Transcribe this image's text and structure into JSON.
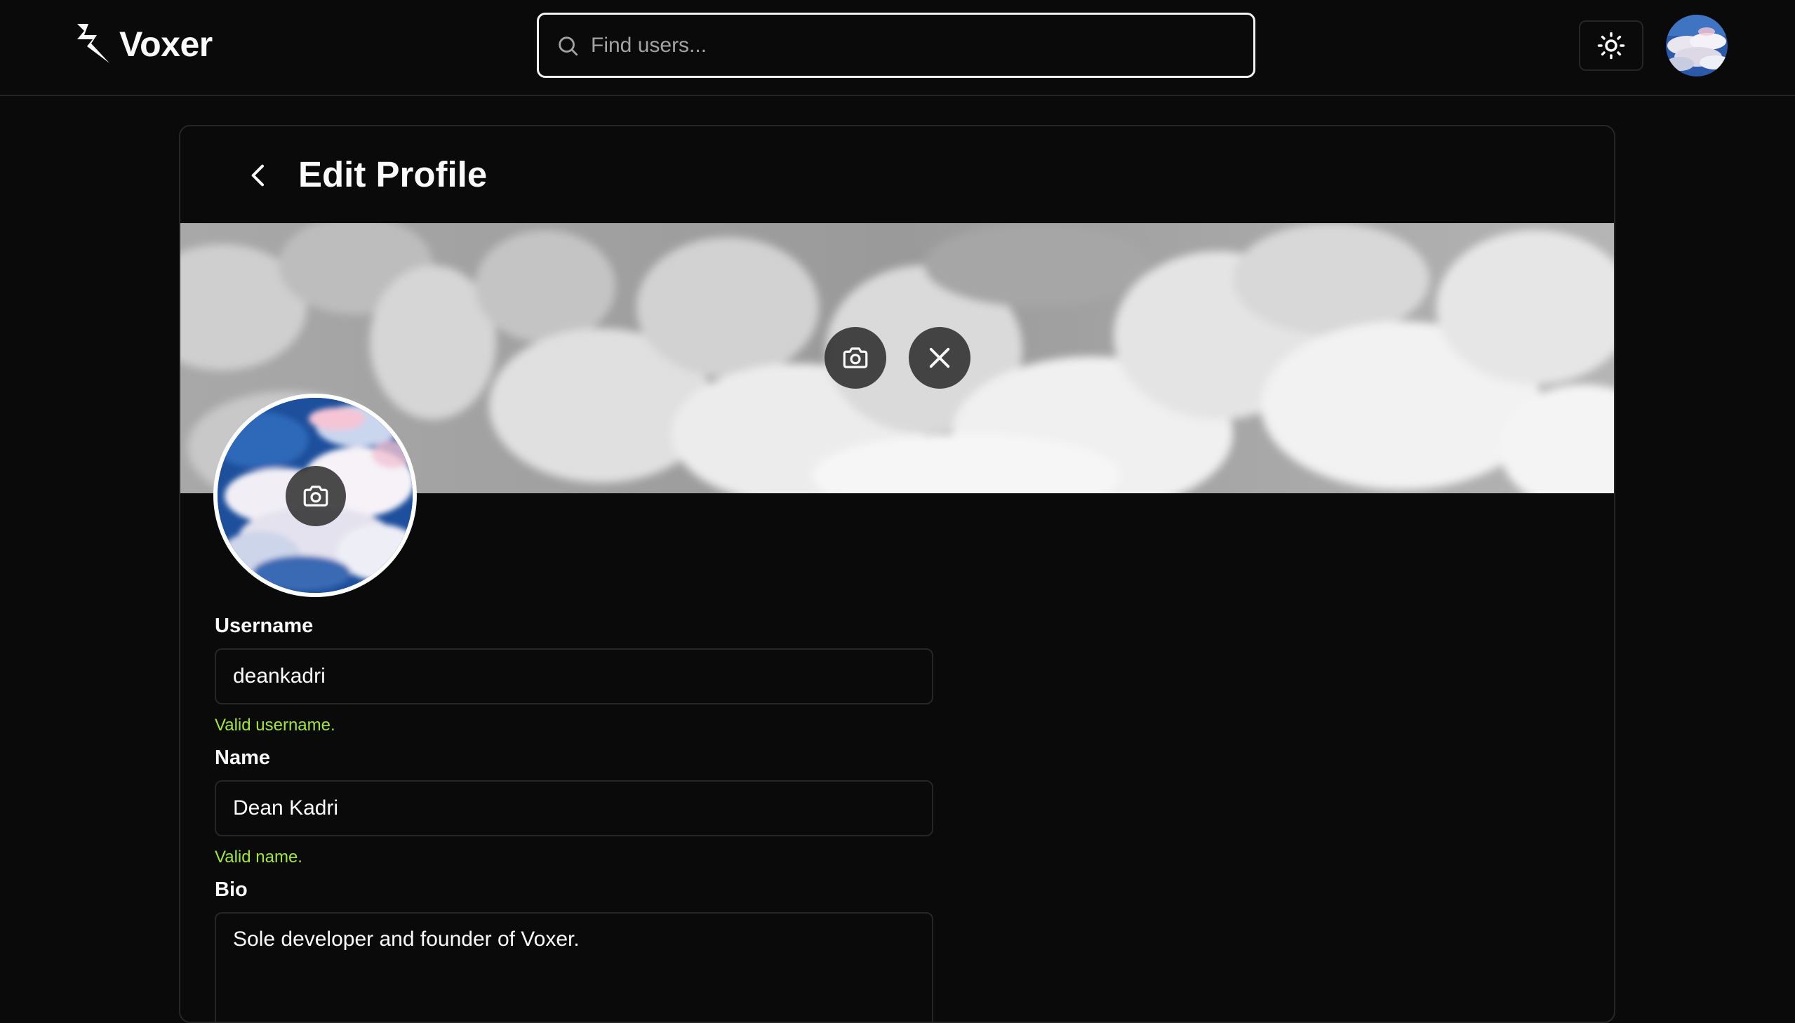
{
  "brand": {
    "name": "Voxer"
  },
  "search": {
    "placeholder": "Find users..."
  },
  "icons": {
    "logo": "lightning-bolt-icon",
    "search": "search-icon",
    "theme": "sun-icon",
    "back": "chevron-left-icon",
    "camera": "camera-icon",
    "close": "close-icon"
  },
  "page": {
    "title": "Edit Profile"
  },
  "form": {
    "username": {
      "label": "Username",
      "value": "deankadri",
      "status": "Valid username."
    },
    "name": {
      "label": "Name",
      "value": "Dean Kadri",
      "status": "Valid name."
    },
    "bio": {
      "label": "Bio",
      "value": "Sole developer and founder of Voxer."
    }
  },
  "colors": {
    "background": "#0a0a0a",
    "border": "#262626",
    "valid": "#a3e635",
    "text": "#fafafa"
  }
}
